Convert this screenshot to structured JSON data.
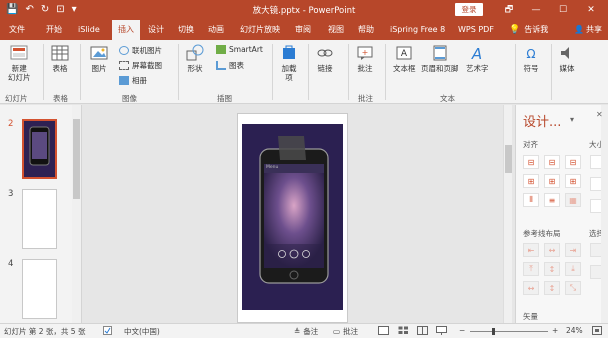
{
  "app": {
    "title": "放大镜.pptx  -  PowerPoint",
    "login": "登录"
  },
  "window_controls": {
    "restore": "🗗",
    "minimize": "—",
    "maximize": "☐",
    "close": "✕"
  },
  "quick_access": {
    "save": "💾",
    "undo": "↶",
    "redo": "↻",
    "start": "⊡",
    "more": "▾"
  },
  "tabs": [
    "文件",
    "开始",
    "iSlide",
    "插入",
    "设计",
    "切换",
    "动画",
    "幻灯片放映",
    "审阅",
    "视图",
    "帮助",
    "iSpring Free 8",
    "WPS PDF",
    "告诉我"
  ],
  "active_tab": "插入",
  "share": "共享",
  "ribbon": {
    "new_slide": "新建\n幻灯片",
    "table": "表格",
    "picture": "图片",
    "online_picture": "联机图片",
    "screenshot": "屏幕截图",
    "album": "相册",
    "shapes": "形状",
    "smartart": "SmartArt",
    "chart": "图表",
    "addins": "加载\n项",
    "link": "链接",
    "comment": "批注",
    "textbox": "文本框",
    "header_footer": "页眉和页脚",
    "wordart": "艺术字",
    "symbol": "符号",
    "media": "媒体",
    "groups": [
      "幻灯片",
      "表格",
      "图像",
      "插图",
      "批注",
      "文本"
    ]
  },
  "thumbnails": {
    "numbers": [
      "2",
      "3",
      "4"
    ],
    "selected": "2"
  },
  "slide": {
    "phone_header": "Menu"
  },
  "task_pane": {
    "title": "设计...",
    "pin": "▾",
    "close": "✕",
    "align_label": "对齐",
    "size_label": "大小",
    "guides_label": "参考线布局",
    "select_label": "选择",
    "vector_label": "矢量"
  },
  "status": {
    "slide_info": "幻灯片 第 2 张，共 5 张",
    "language": "中文(中国)",
    "notes": "备注",
    "comments": "批注",
    "zoom": "24%"
  },
  "colors": {
    "accent": "#b7472a",
    "ribbon_bg": "#f3f3f3",
    "phone_bg": "#2b2051"
  }
}
